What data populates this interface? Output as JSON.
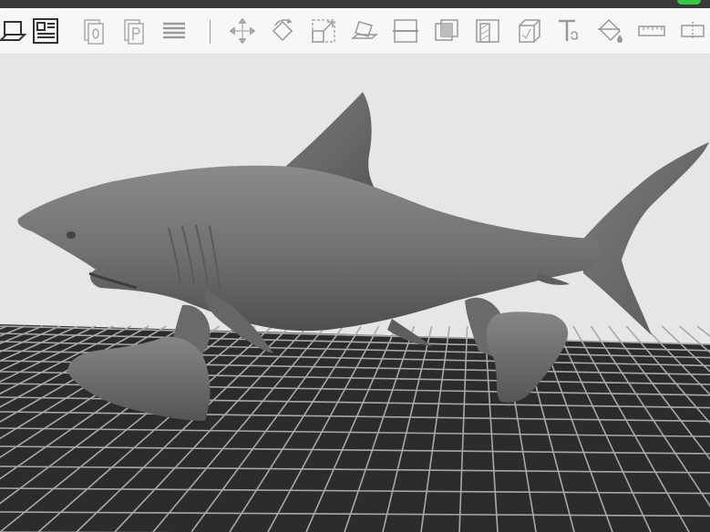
{
  "app": {
    "accent_color": "#2ecc40"
  },
  "toolbar": {
    "tools": [
      "slice-preview-icon",
      "layout-view-icon",
      "object-info-icon",
      "print-icon",
      "layers-icon",
      "move-icon",
      "rotate-icon",
      "scale-icon",
      "lay-flat-icon",
      "cut-icon",
      "hollow-icon",
      "drain-holes-icon",
      "add-box-icon",
      "text-icon",
      "paint-supports-icon",
      "ruler-icon",
      "mirror-icon"
    ]
  },
  "viewport": {
    "model": "shark-model",
    "build_plate": "grid"
  }
}
